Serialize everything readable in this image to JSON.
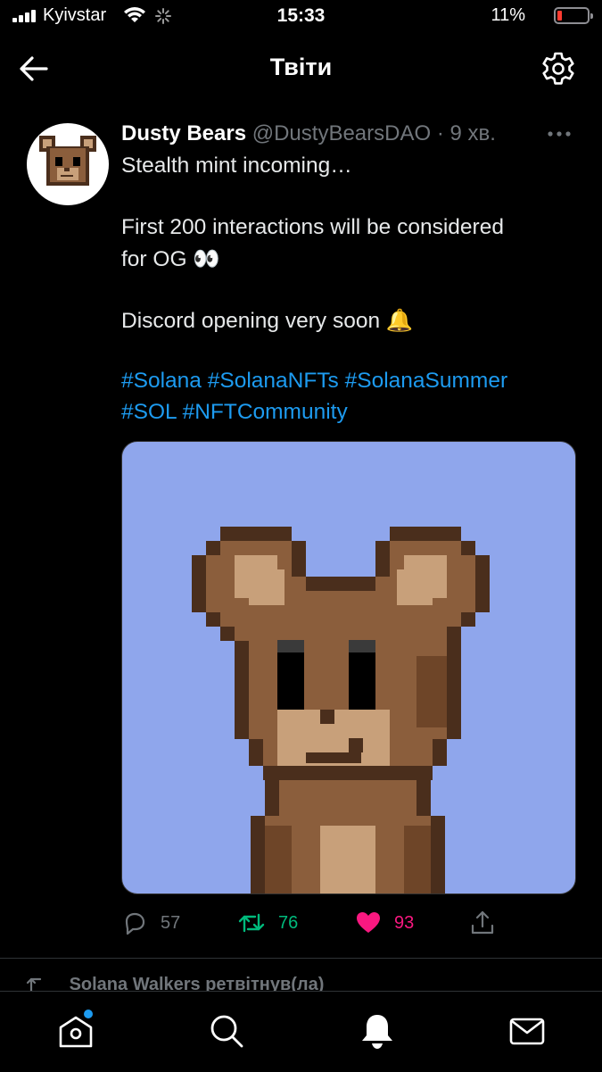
{
  "status": {
    "carrier": "Kyivstar",
    "time": "15:33",
    "battery": "11%",
    "battery_level": 0.11
  },
  "header": {
    "title": "Твіти"
  },
  "tweet": {
    "name": "Dusty Bears",
    "handle": "@DustyBearsDAO",
    "separator": "·",
    "time": "9 хв.",
    "lines": [
      "Stealth mint incoming…",
      "First 200 interactions will be considered",
      "for OG 👀",
      "Discord opening very soon 🔔"
    ],
    "hashtags": [
      [
        "#Solana",
        "#SolanaNFTs",
        "#SolanaSummer"
      ],
      [
        "#SOL",
        "#NFTCommunity"
      ]
    ],
    "replies": "57",
    "retweets": "76",
    "likes": "93"
  },
  "next": {
    "retweet_text": "Solana Walkers ретвітнув(ла)"
  },
  "colors": {
    "accent": "#1d9bf0",
    "retweet": "#00ba7c",
    "like": "#f91880",
    "media_bg": "#8fa6ec"
  }
}
